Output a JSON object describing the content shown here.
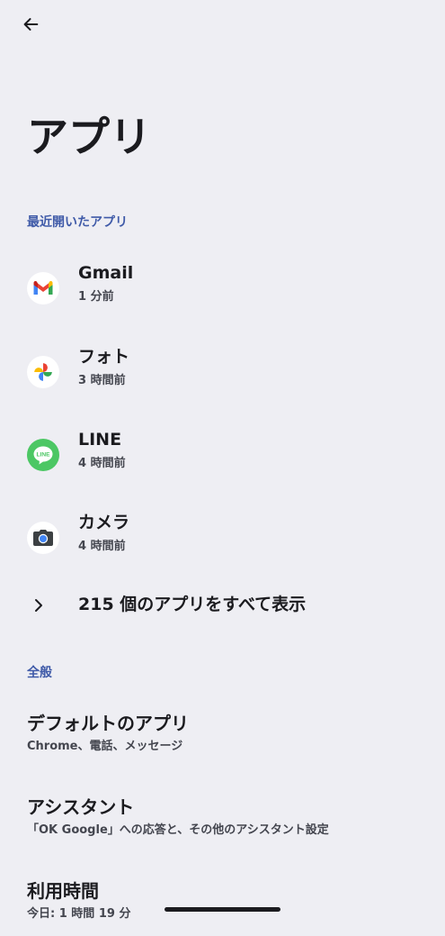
{
  "header": {
    "back_icon": "arrow-left-icon",
    "title": "アプリ"
  },
  "recent": {
    "section_title": "最近開いたアプリ",
    "apps": [
      {
        "name": "Gmail",
        "time": "1 分前",
        "icon": "gmail-icon"
      },
      {
        "name": "フォト",
        "time": "3 時間前",
        "icon": "google-photos-icon"
      },
      {
        "name": "LINE",
        "time": "4 時間前",
        "icon": "line-icon"
      },
      {
        "name": "カメラ",
        "time": "4 時間前",
        "icon": "camera-icon"
      }
    ],
    "show_all_label": "215 個のアプリをすべて表示",
    "show_all_icon": "chevron-right-icon"
  },
  "general": {
    "section_title": "全般",
    "items": [
      {
        "title": "デフォルトのアプリ",
        "subtitle": "Chrome、電話、メッセージ"
      },
      {
        "title": "アシスタント",
        "subtitle": "「OK Google」への応答と、その他のアシスタント設定"
      },
      {
        "title": "利用時間",
        "subtitle": "今日: 1 時間 19 分"
      }
    ]
  },
  "colors": {
    "background": "#EEEEF3",
    "accent": "#3F5AA8",
    "text_primary": "#1B1B1F",
    "text_secondary": "#44464F"
  }
}
